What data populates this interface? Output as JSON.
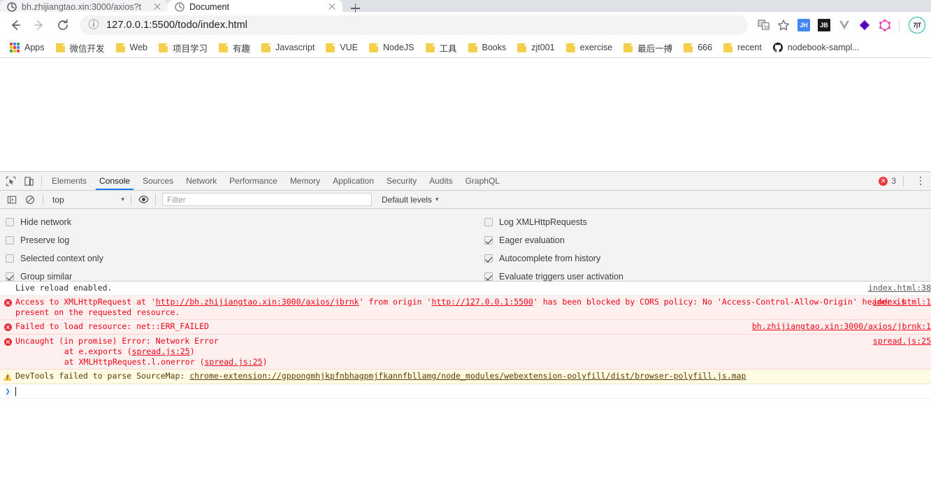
{
  "browser": {
    "tabs": [
      {
        "title": "bh.zhijiangtao.xin:3000/axios?t",
        "active": false
      },
      {
        "title": "Document",
        "active": true
      }
    ],
    "newtab_label": "+",
    "nav": {
      "back": "back-arrow",
      "forward": "forward-arrow",
      "reload": "reload"
    },
    "omnibox": {
      "info_glyph": "ⓘ",
      "url": "127.0.0.1:5500/todo/index.html"
    },
    "toolbar_icons": [
      {
        "name": "translate-icon",
        "label": ""
      },
      {
        "name": "bookmark-star-icon",
        "label": ""
      },
      {
        "name": "extension-jh-icon",
        "label": "JH"
      },
      {
        "name": "extension-jb-icon",
        "label": "JB"
      },
      {
        "name": "extension-vue-icon",
        "label": "V"
      },
      {
        "name": "extension-diamond-icon",
        "label": ""
      },
      {
        "name": "extension-graphql-icon",
        "label": ""
      }
    ],
    "avatar_label": "7|T",
    "bookmarks": [
      {
        "label": "Apps",
        "icon": "apps-grid"
      },
      {
        "label": "微信开发",
        "icon": "folder"
      },
      {
        "label": "Web",
        "icon": "folder"
      },
      {
        "label": "项目学习",
        "icon": "folder"
      },
      {
        "label": "有趣",
        "icon": "folder"
      },
      {
        "label": "Javascript",
        "icon": "folder"
      },
      {
        "label": "VUE",
        "icon": "folder"
      },
      {
        "label": "NodeJS",
        "icon": "folder"
      },
      {
        "label": "工具",
        "icon": "folder"
      },
      {
        "label": "Books",
        "icon": "folder"
      },
      {
        "label": "zjt001",
        "icon": "folder"
      },
      {
        "label": "exercise",
        "icon": "folder"
      },
      {
        "label": "最后一搏",
        "icon": "folder"
      },
      {
        "label": "666",
        "icon": "folder"
      },
      {
        "label": "recent",
        "icon": "folder"
      },
      {
        "label": "nodebook-sampl...",
        "icon": "github"
      }
    ]
  },
  "devtools": {
    "panels": [
      {
        "label": "Elements",
        "selected": false
      },
      {
        "label": "Console",
        "selected": true
      },
      {
        "label": "Sources",
        "selected": false
      },
      {
        "label": "Network",
        "selected": false
      },
      {
        "label": "Performance",
        "selected": false
      },
      {
        "label": "Memory",
        "selected": false
      },
      {
        "label": "Application",
        "selected": false
      },
      {
        "label": "Security",
        "selected": false
      },
      {
        "label": "Audits",
        "selected": false
      },
      {
        "label": "GraphQL",
        "selected": false
      }
    ],
    "error_count": "3",
    "filterbar": {
      "context": "top",
      "context_caret": "▾",
      "filter_placeholder": "Filter",
      "levels": "Default levels",
      "levels_caret": "▾"
    },
    "settings_left": [
      {
        "label": "Hide network",
        "checked": false
      },
      {
        "label": "Preserve log",
        "checked": false
      },
      {
        "label": "Selected context only",
        "checked": false
      },
      {
        "label": "Group similar",
        "checked": true
      }
    ],
    "settings_right": [
      {
        "label": "Log XMLHttpRequests",
        "checked": false
      },
      {
        "label": "Eager evaluation",
        "checked": true
      },
      {
        "label": "Autocomplete from history",
        "checked": true
      },
      {
        "label": "Evaluate triggers user activation",
        "checked": true
      }
    ],
    "messages": [
      {
        "level": "info",
        "text": "Live reload enabled.",
        "source": "index.html:38"
      },
      {
        "level": "error",
        "text_parts": [
          {
            "t": "Access to XMLHttpRequest at '",
            "link": false
          },
          {
            "t": "http://bh.zhijiangtao.xin:3000/axios/jbrnk",
            "link": true
          },
          {
            "t": "' from origin '",
            "link": false
          },
          {
            "t": "http://127.0.0.1:5500",
            "link": true
          },
          {
            "t": "' has been blocked by CORS policy: No 'Access-Control-Allow-Origin' header is present on the requested resource.",
            "link": false
          }
        ],
        "source": "index.html:1"
      },
      {
        "level": "error",
        "text": "Failed to load resource: net::ERR_FAILED",
        "source": "bh.zhijiangtao.xin:3000/axios/jbrnk:1"
      },
      {
        "level": "error",
        "text": "Uncaught (in promise) Error: Network Error",
        "stack": [
          {
            "prefix": "    at e.exports (",
            "link": "spread.js:25",
            "suffix": ")"
          },
          {
            "prefix": "    at XMLHttpRequest.l.onerror (",
            "link": "spread.js:25",
            "suffix": ")"
          }
        ],
        "source": "spread.js:25"
      },
      {
        "level": "warning",
        "text_parts": [
          {
            "t": "DevTools failed to parse SourceMap: ",
            "link": false
          },
          {
            "t": "chrome-extension://gppongmhjkpfnbhagpmjfkannfbllamg/node_modules/webextension-polyfill/dist/browser-polyfill.js.map",
            "link": true
          }
        ],
        "source": ""
      }
    ],
    "prompt_arrow": "❯"
  }
}
